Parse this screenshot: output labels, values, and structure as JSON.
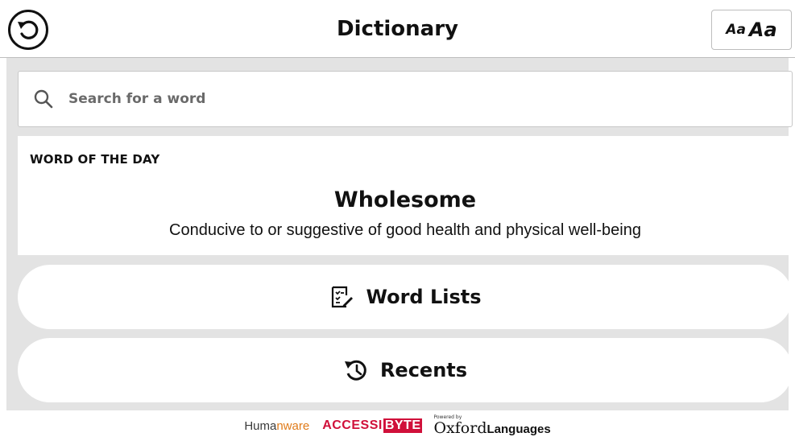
{
  "header": {
    "title": "Dictionary",
    "back_icon": "undo-arrow-icon",
    "font_size_small": "Aa",
    "font_size_large": "Aa"
  },
  "search": {
    "placeholder": "Search for a word",
    "value": "",
    "icon": "search-icon"
  },
  "word_of_the_day": {
    "label": "WORD OF THE DAY",
    "word": "Wholesome",
    "definition": "Conducive to or suggestive of good health and physical well-being"
  },
  "menu": {
    "word_lists": {
      "label": "Word Lists",
      "icon": "word-list-edit-icon"
    },
    "recents": {
      "label": "Recents",
      "icon": "history-icon"
    }
  },
  "footer": {
    "humanware_a": "Huma",
    "humanware_n": "n",
    "humanware_b": "ware",
    "accessibyte_a": "ACCESSI",
    "accessibyte_b": "BYTE",
    "powered_by": "Powered by",
    "oxford": "Oxford",
    "languages": "Languages"
  },
  "colors": {
    "background_panel": "#e3e3e3",
    "humanware_accent": "#e07b1a",
    "accessibyte_red": "#d0103a"
  }
}
